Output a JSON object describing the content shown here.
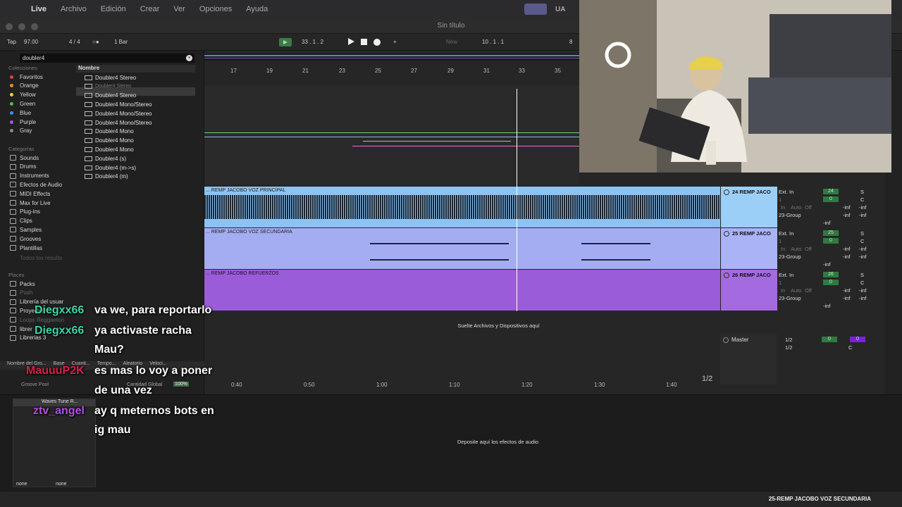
{
  "menubar": {
    "apple": "",
    "items": [
      "Live",
      "Archivo",
      "Edición",
      "Crear",
      "Ver",
      "Opciones",
      "Ayuda"
    ],
    "ua": "UA"
  },
  "window": {
    "title": "Sin título"
  },
  "control": {
    "tap": "Tap",
    "tempo": "97.00",
    "sig": "4 / 4",
    "metro": "○●",
    "quant": "1 Bar",
    "position": "33 .   1 .   2",
    "loop": "10 .   1 .   1",
    "new_label": "New",
    "right_num": "8"
  },
  "browser": {
    "search_value": "doubler4",
    "colecciones_label": "Colecciones",
    "collections": [
      {
        "label": "Favoritos",
        "color": "#e0433b"
      },
      {
        "label": "Orange",
        "color": "#f08a2a"
      },
      {
        "label": "Yellow",
        "color": "#e4d33a"
      },
      {
        "label": "Green",
        "color": "#4fbf4a"
      },
      {
        "label": "Blue",
        "color": "#3c8ff0"
      },
      {
        "label": "Purple",
        "color": "#a159e4"
      },
      {
        "label": "Gray",
        "color": "#8a8a8a"
      }
    ],
    "categorias_label": "Categorías",
    "categories": [
      "Sounds",
      "Drums",
      "Instruments",
      "Efectos de Audio",
      "MIDI Effects",
      "Max for Live",
      "Plug-ins",
      "Clips",
      "Samples",
      "Grooves",
      "Plantillas"
    ],
    "show_results": "Todos los resulta",
    "lugares_label": "Places",
    "places": [
      "Packs",
      "Push",
      "Librería del usuar",
      "Proyectos",
      "Loops Reggaeton",
      "librer",
      "Librerias 3"
    ],
    "name_header": "Nombre",
    "presets": [
      "Doubler4 Stereo",
      "Doubler4 Stereo",
      "Doubler4 Stereo",
      "Doubler4 Mono/Stereo",
      "Doubler4 Mono/Stereo",
      "Doubler4 Mono/Stereo",
      "Doubler4 Mono",
      "Doubler4 Mono",
      "Doubler4 Mono",
      "Doubler4 (s)",
      "Doubler4 (m->s)",
      "Doubler4 (m)"
    ]
  },
  "groove": {
    "cols": [
      "Nombre del Gro...",
      "Base",
      "Cuanti...",
      "Tempo...",
      "Aleatorio",
      "Veloci..."
    ],
    "pool": "Groove Pool",
    "cantidad": "Cantidad Global",
    "pct": "100%"
  },
  "arrangement": {
    "ruler": [
      "17",
      "19",
      "21",
      "23",
      "25",
      "27",
      "29",
      "31",
      "33",
      "35"
    ],
    "tracks": [
      {
        "title": "... REMP JACOBO VOZ PRINCIPAL",
        "color": "#8cc3f2",
        "head_color": "#9ccff7",
        "mixer_name": "24 REMP JACO",
        "num": "24"
      },
      {
        "title": "... REMP JACOBO VOZ SECUNDARIA",
        "color": "#a4adf2",
        "head_color": "#a9b3f5",
        "mixer_name": "25 REMP JACO",
        "num": "25"
      },
      {
        "title": "... REMP JACOBO REFUERZOS",
        "color": "#9a5cd8",
        "head_color": "#a46ae0",
        "mixer_name": "26 REMP JACO",
        "num": "26"
      }
    ],
    "drop_clips": "Suelte Archivos y Dispositivos aquí",
    "times": [
      "0:40",
      "0:50",
      "1:00",
      "1:10",
      "1:20",
      "1:30",
      "1:40"
    ],
    "page": "1/2"
  },
  "mixer": {
    "ext_in": "Ext. In",
    "one": "1",
    "in": "In",
    "auto": "Auto",
    "off": "Off",
    "group": "23-Group",
    "s": "S",
    "c": "C",
    "zero": "0",
    "inf": "-inf",
    "master": "Master",
    "half": "1/2"
  },
  "device": {
    "plugin": "Waves Tune R...",
    "drop_fx": "Deposite aquí los efectos de audio",
    "sel1": "none",
    "sel2": "none"
  },
  "status": {
    "text": "25-REMP JACOBO VOZ SECUNDARIA"
  },
  "chat": [
    {
      "user": "Diegxx66",
      "user_color": "#3bd5a8",
      "lines": [
        "va we, para reportarlo"
      ]
    },
    {
      "user": "Diegxx66",
      "user_color": "#3bd5a8",
      "lines": [
        "ya activaste racha",
        "Mau?"
      ]
    },
    {
      "user": "MauuuP2K",
      "user_color": "#d8204c",
      "lines": [
        "es mas lo voy a poner",
        "de una vez"
      ]
    },
    {
      "user": "ztv_angel",
      "user_color": "#b24ee8",
      "lines": [
        "ay q meternos bots en",
        "ig mau"
      ]
    }
  ]
}
